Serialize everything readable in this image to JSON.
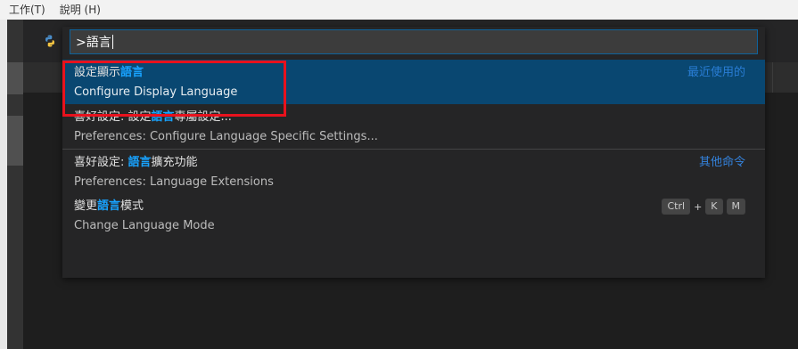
{
  "menubar": {
    "items": [
      "工作(T)",
      "說明 (H)"
    ]
  },
  "quick_pick": {
    "input_value": ">語言",
    "items": [
      {
        "label_parts": [
          {
            "text": "設定顯示",
            "hl": false
          },
          {
            "text": "語言",
            "hl": true
          }
        ],
        "detail": "Configure Display Language",
        "group": "最近使用的",
        "selected": true
      },
      {
        "label_parts": [
          {
            "text": "喜好設定: 設定",
            "hl": false
          },
          {
            "text": "語言",
            "hl": true
          },
          {
            "text": "專屬設定...",
            "hl": false
          }
        ],
        "detail": "Preferences: Configure Language Specific Settings...",
        "selected": false
      },
      {
        "label_parts": [
          {
            "text": "喜好設定: ",
            "hl": false
          },
          {
            "text": "語言",
            "hl": true
          },
          {
            "text": "擴充功能",
            "hl": false
          }
        ],
        "detail": "Preferences: Language Extensions",
        "group": "其他命令",
        "selected": false
      },
      {
        "label_parts": [
          {
            "text": "變更",
            "hl": false
          },
          {
            "text": "語言",
            "hl": true
          },
          {
            "text": "模式",
            "hl": false
          }
        ],
        "detail": "Change Language Mode",
        "keybinding": [
          "Ctrl",
          "+",
          "K",
          "M"
        ],
        "selected": false
      }
    ]
  },
  "colors": {
    "accent": "#0e639c",
    "selection": "#094771",
    "highlight": "#18a3ff",
    "annotation": "#e8121d"
  },
  "icons": {
    "app": "python-icon"
  }
}
